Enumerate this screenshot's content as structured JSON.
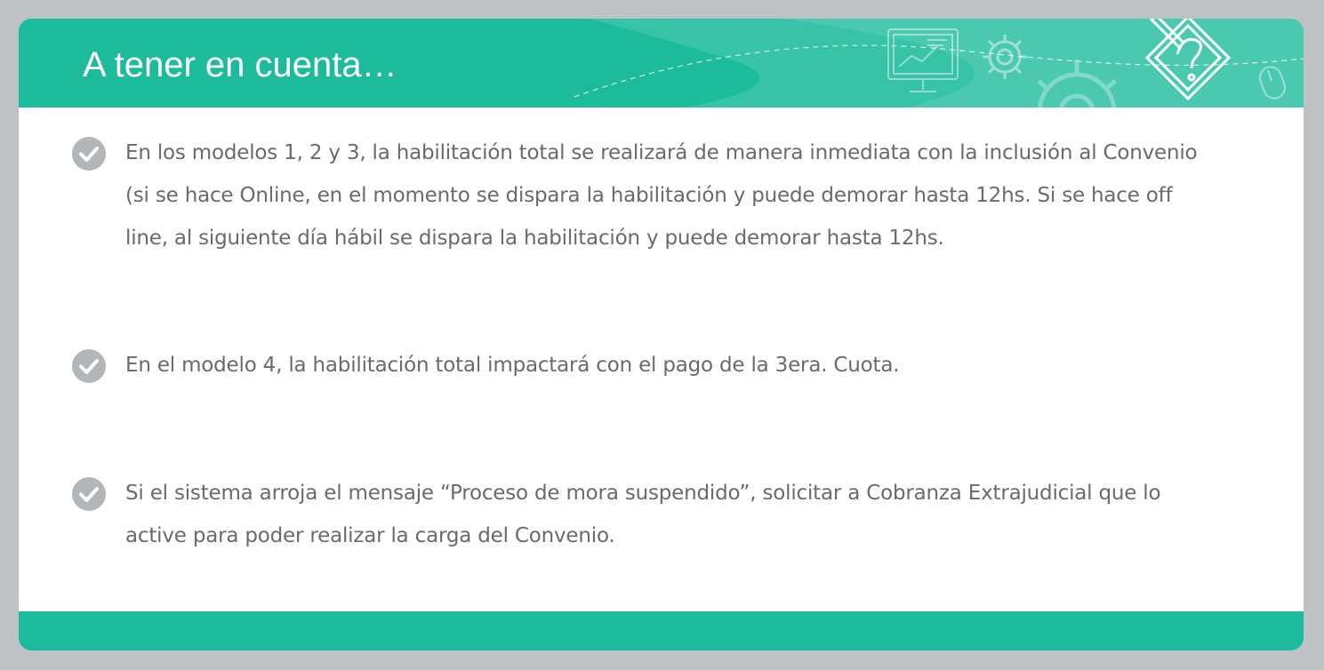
{
  "slide": {
    "title": "A tener en cuenta…",
    "header_icons": [
      "presentation-chart-icon",
      "gear-icon",
      "gear-large-icon",
      "pencil-edit-icon",
      "mouse-icon"
    ],
    "items": [
      {
        "icon": "check-circle-icon",
        "text": "En los modelos 1, 2 y 3, la habilitación total se realizará de manera inmediata con la inclusión al Convenio (si se hace Online, en el momento se dispara la habilitación y puede demorar hasta 12hs. Si se hace off line, al siguiente día hábil se dispara la habilitación y puede demorar hasta 12hs."
      },
      {
        "icon": "check-circle-icon",
        "text": "En el modelo 4, la habilitación total impactará con el pago de la 3era. Cuota."
      },
      {
        "icon": "check-circle-icon",
        "text": "Si el sistema arroja el mensaje “Proceso de mora suspendido”, solicitar a Cobranza Extrajudicial que lo active para poder realizar la carga del Convenio."
      }
    ]
  },
  "colors": {
    "accent": "#1cbb9b",
    "text": "#6a6a6a",
    "check": "#b3b6b9",
    "background": "#bfc2c5"
  }
}
